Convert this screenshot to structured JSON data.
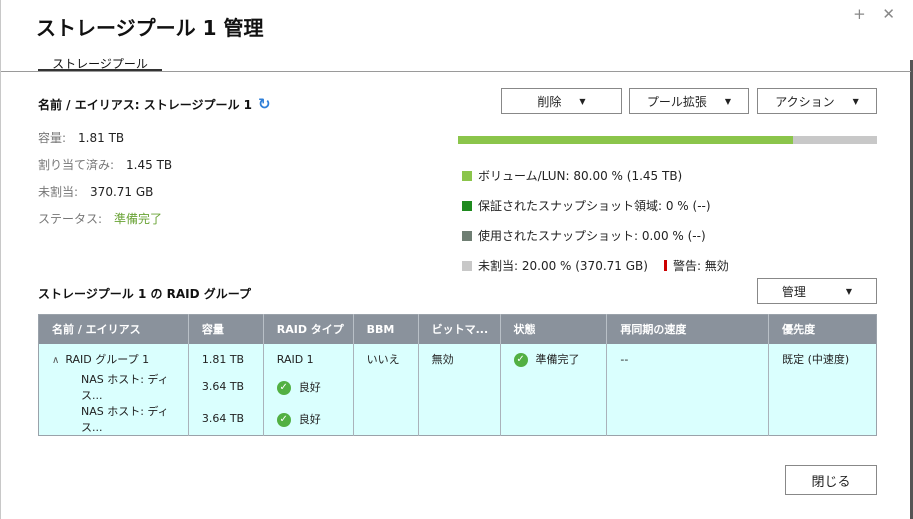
{
  "window": {
    "title": "ストレージプール 1 管理",
    "icons": "+ ✕"
  },
  "tabs": [
    {
      "label": "ストレージプール"
    }
  ],
  "pool": {
    "name_label": "名前 / エイリアス: ストレージプール 1",
    "capacity_label": "容量:",
    "capacity_value": "1.81 TB",
    "allocated_label": "割り当て済み:",
    "allocated_value": "1.45 TB",
    "unallocated_label": "未割当:",
    "unallocated_value": "370.71 GB",
    "status_label": "ステータス:",
    "status_value": "準備完了"
  },
  "toolbar": {
    "delete_label": "削除",
    "expand_label": "プール拡張",
    "action_label": "アクション"
  },
  "usage": {
    "fill_fraction": 0.8,
    "volume_legend": "ボリューム/LUN: 80.00 % (1.45 TB)",
    "guaranteed_legend": "保証されたスナップショット領域: 0 % (--)",
    "used_snapshot_legend": "使用されたスナップショット: 0.00 % (--)",
    "unallocated_legend": "未割当: 20.00 % (370.71 GB)",
    "warning_legend": "警告: 無効",
    "colors": {
      "volume": "#8bc54b",
      "guaranteed": "#1e8a1e",
      "used_snapshot": "#6f7e73",
      "unallocated": "#c8c8c8",
      "warning": "#cc0000"
    }
  },
  "raid_section": {
    "title": "ストレージプール 1 の RAID グループ",
    "manage_label": "管理",
    "columns": [
      "名前 / エイリアス",
      "容量",
      "RAID タイプ",
      "BBM",
      "ビットマ...",
      "状態",
      "再同期の速度",
      "優先度"
    ],
    "group": {
      "name": "RAID グループ 1",
      "capacity": "1.81 TB",
      "raid_type": "RAID 1",
      "bbm": "いいえ",
      "bitmap": "無効",
      "status": "準備完了",
      "resync_speed": "--",
      "priority": "既定 (中速度)"
    },
    "disks": [
      {
        "name": "NAS ホスト: ディス...",
        "capacity": "3.64 TB",
        "status": "良好"
      },
      {
        "name": "NAS ホスト: ディス...",
        "capacity": "3.64 TB",
        "status": "良好"
      }
    ]
  },
  "footer": {
    "close_label": "閉じる"
  }
}
